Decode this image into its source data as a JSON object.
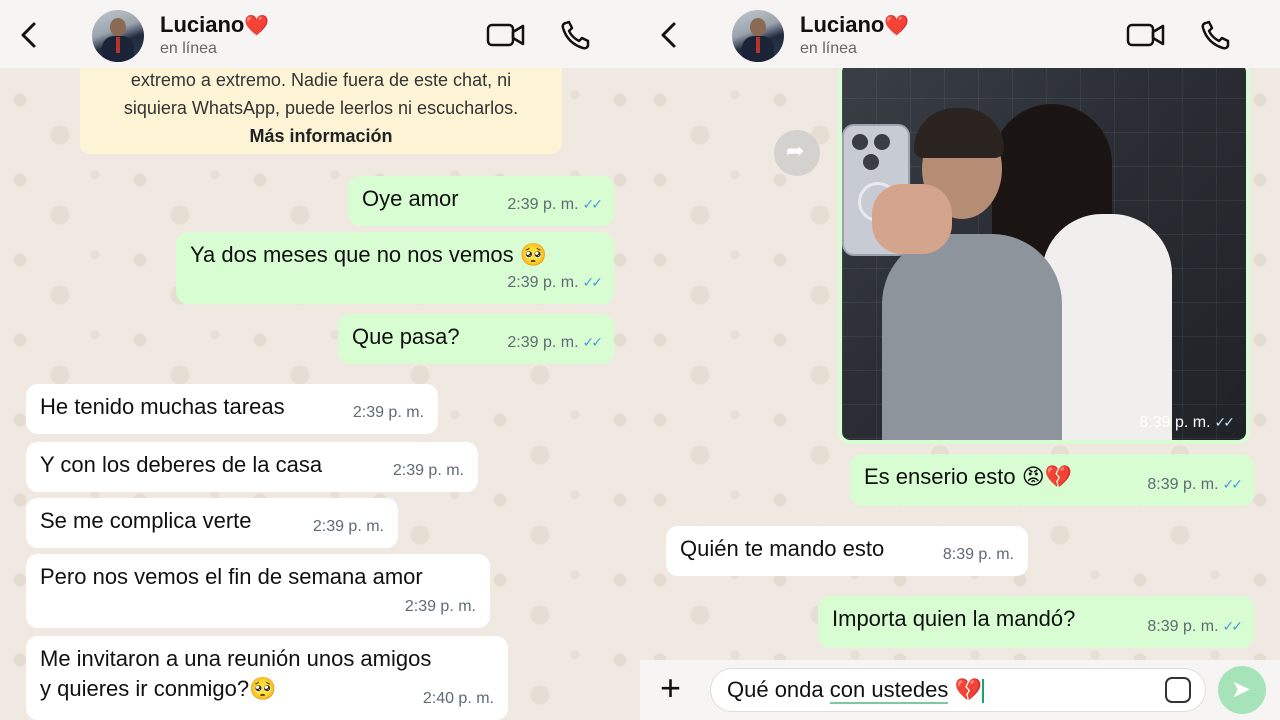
{
  "header": {
    "name": "Luciano",
    "heart": "❤️",
    "status": "en línea"
  },
  "encryption_notice": {
    "line1": "extremo a extremo. Nadie fuera de este chat, ni",
    "line2": "siquiera WhatsApp, puede leerlos ni escucharlos.",
    "link": "Más información"
  },
  "left_messages": [
    {
      "dir": "out",
      "text": "Oye amor",
      "time": "2:39 p. m.",
      "ticks": "✓✓"
    },
    {
      "dir": "out",
      "text": "Ya dos meses que no nos vemos 🥺",
      "time": "2:39 p. m.",
      "ticks": "✓✓"
    },
    {
      "dir": "out",
      "text": "Que pasa?",
      "time": "2:39 p. m.",
      "ticks": "✓✓"
    },
    {
      "dir": "in",
      "text": "He tenido muchas tareas",
      "time": "2:39 p. m."
    },
    {
      "dir": "in",
      "text": "Y con los deberes de la casa",
      "time": "2:39 p. m."
    },
    {
      "dir": "in",
      "text": "Se me complica verte",
      "time": "2:39 p. m."
    },
    {
      "dir": "in",
      "text": "Pero nos vemos el fin de semana amor",
      "time": "2:39 p. m."
    },
    {
      "dir": "in",
      "text_line1": "Me invitaron a una reunión unos amigos",
      "text_line2": "y quieres ir conmigo?🥺",
      "time": "2:40 p. m."
    }
  ],
  "right_messages": [
    {
      "dir": "out",
      "type": "photo",
      "time": "8:39 p. m.",
      "ticks": "✓✓"
    },
    {
      "dir": "out",
      "text": "Es enserio esto 😡💔",
      "time": "8:39 p. m.",
      "ticks": "✓✓"
    },
    {
      "dir": "in",
      "text": "Quién te mando esto",
      "time": "8:39 p. m."
    },
    {
      "dir": "out",
      "text": "Importa quien la mandó?",
      "time": "8:39 p. m.",
      "ticks": "✓✓"
    }
  ],
  "composer": {
    "text_a": "Qué onda ",
    "text_b": "con ustedes",
    "text_c": " 💔"
  }
}
